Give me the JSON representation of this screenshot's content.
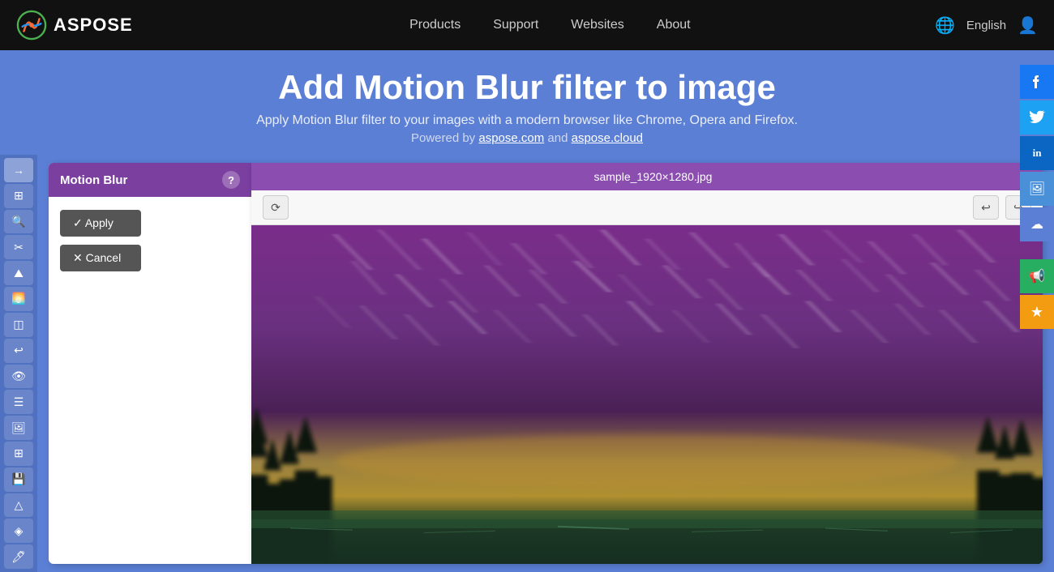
{
  "nav": {
    "logo_text": "ASPOSE",
    "links": [
      {
        "label": "Products",
        "id": "products"
      },
      {
        "label": "Support",
        "id": "support"
      },
      {
        "label": "Websites",
        "id": "websites"
      },
      {
        "label": "About",
        "id": "about"
      }
    ],
    "language": "English"
  },
  "hero": {
    "title": "Add Motion Blur filter to image",
    "subtitle": "Apply Motion Blur filter to your images with a modern browser like Chrome, Opera and Firefox.",
    "powered": "Powered by aspose.com and aspose.cloud"
  },
  "filter_panel": {
    "title": "Motion Blur",
    "help_label": "?",
    "apply_label": "✓ Apply",
    "cancel_label": "✕ Cancel"
  },
  "image_viewer": {
    "filename": "sample_1920×1280.jpg",
    "close_label": "✕",
    "undo_label": "↩",
    "redo_label": "↪",
    "rotate_label": "⟳"
  },
  "social": {
    "facebook": "f",
    "twitter": "t",
    "linkedin": "in",
    "image": "🖼",
    "cloud": "☁",
    "announce": "📢",
    "star": "★"
  },
  "toolbar": {
    "tools": [
      {
        "icon": "→",
        "name": "arrow"
      },
      {
        "icon": "⊞",
        "name": "grid"
      },
      {
        "icon": "🔍",
        "name": "zoom"
      },
      {
        "icon": "✂",
        "name": "crop"
      },
      {
        "icon": "⛰",
        "name": "landscape"
      },
      {
        "icon": "🌅",
        "name": "filter"
      },
      {
        "icon": "◫",
        "name": "frame"
      },
      {
        "icon": "↩",
        "name": "undo-tool"
      },
      {
        "icon": "👁",
        "name": "preview"
      },
      {
        "icon": "☰",
        "name": "menu"
      },
      {
        "icon": "🖼",
        "name": "image"
      },
      {
        "icon": "⊞",
        "name": "grid2"
      },
      {
        "icon": "💾",
        "name": "save"
      },
      {
        "icon": "△",
        "name": "triangle"
      },
      {
        "icon": "◈",
        "name": "shape"
      },
      {
        "icon": "🖊",
        "name": "pencil"
      }
    ]
  }
}
